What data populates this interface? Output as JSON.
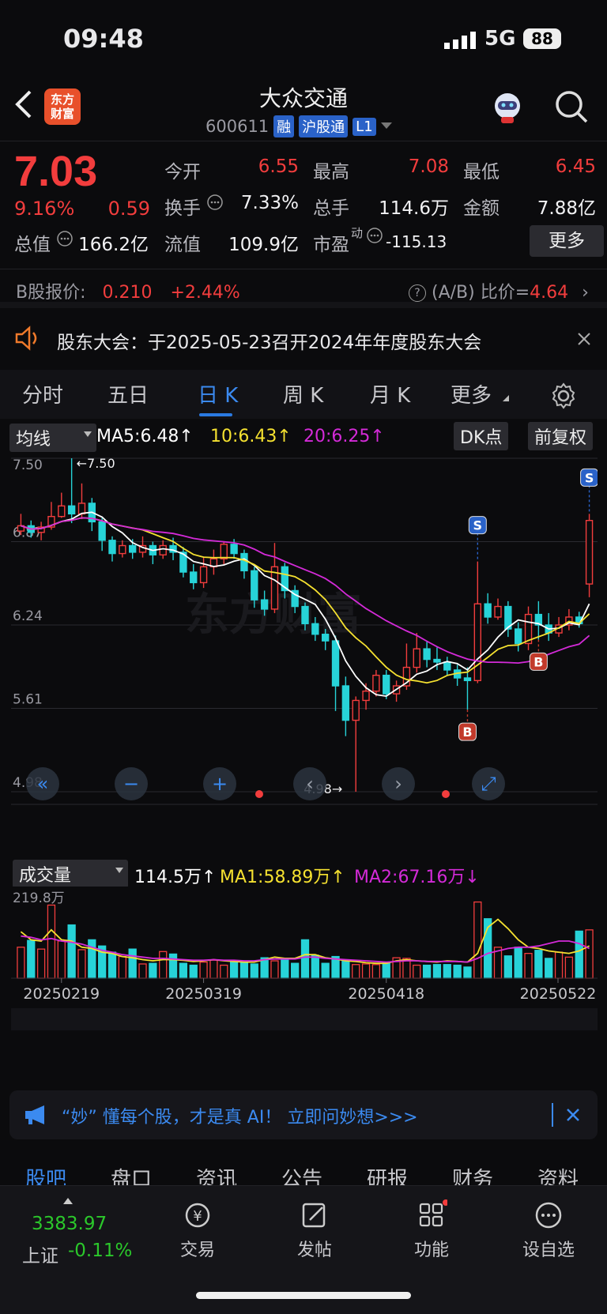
{
  "status_bar": {
    "time": "09:48",
    "network": "5G",
    "battery": "88"
  },
  "header": {
    "logo_text_line1": "东方",
    "logo_text_line2": "财富",
    "title": "大众交通",
    "code": "600611",
    "tags": [
      "融",
      "沪股通",
      "L1"
    ]
  },
  "quote": {
    "price": "7.03",
    "change_pct": "9.16%",
    "change_amt": "0.59",
    "fields": [
      {
        "label": "今开",
        "value": "6.55",
        "color": "red"
      },
      {
        "label": "最高",
        "value": "7.08",
        "color": "red"
      },
      {
        "label": "最低",
        "value": "6.45",
        "color": "red"
      },
      {
        "label": "换手",
        "value": "7.33%",
        "color": "white"
      },
      {
        "label": "总手",
        "value": "114.6万",
        "color": "white"
      },
      {
        "label": "金额",
        "value": "7.88亿",
        "color": "white"
      },
      {
        "label": "总值",
        "value": "166.2亿",
        "color": "white"
      },
      {
        "label": "流值",
        "value": "109.9亿",
        "color": "white"
      },
      {
        "label": "市盈",
        "value": "-115.13",
        "color": "white"
      }
    ],
    "pe_superscript": "动",
    "more_button": "更多"
  },
  "b_share": {
    "label": "B股报价:",
    "price": "0.210",
    "pct": "+2.44%",
    "ratio_label": "(A/B) 比价=",
    "ratio": "4.64"
  },
  "notice": {
    "text": "股东大会：于2025-05-23召开2024年年度股东大会"
  },
  "chart_tabs": [
    {
      "label": "分时"
    },
    {
      "label": "五日"
    },
    {
      "label": "日 K"
    },
    {
      "label": "周 K"
    },
    {
      "label": "月 K"
    },
    {
      "label": "更多"
    }
  ],
  "ma_row": {
    "selector": "均线",
    "ma5": "MA5:6.48↑",
    "ma10": "10:6.43↑",
    "ma20": "20:6.25↑",
    "dk_button": "DK点",
    "adjust_button": "前复权",
    "colors": {
      "ma5": "#ffffff",
      "ma10": "#f5e130",
      "ma20": "#d42ad8"
    }
  },
  "chart_data": [
    {
      "type": "candlestick",
      "y_ticks": [
        "7.50",
        "6.87",
        "6.24",
        "5.61",
        "4.98"
      ],
      "ylim": [
        4.98,
        7.5
      ],
      "max_label": "←7.50",
      "min_label": "4.98→",
      "markers": [
        {
          "type": "S",
          "index": 45
        },
        {
          "type": "S",
          "index": 56
        },
        {
          "type": "B",
          "index": 44
        },
        {
          "type": "B",
          "index": 51
        }
      ],
      "candles": [
        [
          6.95,
          6.99,
          7.08,
          6.92
        ],
        [
          6.99,
          6.94,
          7.03,
          6.9
        ],
        [
          6.94,
          6.98,
          7.02,
          6.88
        ],
        [
          6.98,
          7.06,
          7.17,
          6.96
        ],
        [
          7.06,
          7.14,
          7.24,
          7.05
        ],
        [
          7.14,
          7.08,
          7.5,
          7.01
        ],
        [
          7.08,
          7.16,
          7.31,
          7.04
        ],
        [
          7.16,
          7.02,
          7.2,
          6.95
        ],
        [
          7.02,
          6.88,
          7.05,
          6.8
        ],
        [
          6.88,
          6.78,
          6.91,
          6.72
        ],
        [
          6.78,
          6.84,
          6.88,
          6.75
        ],
        [
          6.84,
          6.79,
          6.89,
          6.74
        ],
        [
          6.79,
          6.84,
          6.91,
          6.75
        ],
        [
          6.84,
          6.77,
          6.87,
          6.7
        ],
        [
          6.77,
          6.84,
          6.88,
          6.74
        ],
        [
          6.84,
          6.79,
          6.9,
          6.73
        ],
        [
          6.79,
          6.64,
          6.83,
          6.6
        ],
        [
          6.64,
          6.56,
          6.7,
          6.51
        ],
        [
          6.56,
          6.68,
          6.75,
          6.52
        ],
        [
          6.68,
          6.74,
          6.81,
          6.62
        ],
        [
          6.74,
          6.85,
          6.87,
          6.7
        ],
        [
          6.85,
          6.78,
          6.89,
          6.74
        ],
        [
          6.78,
          6.65,
          6.81,
          6.59
        ],
        [
          6.65,
          6.43,
          6.68,
          6.37
        ],
        [
          6.43,
          6.36,
          6.5,
          6.31
        ],
        [
          6.36,
          6.68,
          6.86,
          6.33
        ],
        [
          6.68,
          6.5,
          6.71,
          6.44
        ],
        [
          6.5,
          6.38,
          6.54,
          6.33
        ],
        [
          6.38,
          6.25,
          6.41,
          6.2
        ],
        [
          6.25,
          6.17,
          6.3,
          6.12
        ],
        [
          6.17,
          6.12,
          6.21,
          6.05
        ],
        [
          6.12,
          5.78,
          6.16,
          5.59
        ],
        [
          5.78,
          5.52,
          5.85,
          5.4
        ],
        [
          5.52,
          5.67,
          5.7,
          4.98
        ],
        [
          5.67,
          5.74,
          5.8,
          5.6
        ],
        [
          5.74,
          5.86,
          5.9,
          5.7
        ],
        [
          5.86,
          5.72,
          5.9,
          5.68
        ],
        [
          5.72,
          5.78,
          5.82,
          5.66
        ],
        [
          5.78,
          5.92,
          6.1,
          5.75
        ],
        [
          5.92,
          6.06,
          6.18,
          5.88
        ],
        [
          6.06,
          5.98,
          6.12,
          5.92
        ],
        [
          5.98,
          5.96,
          6.07,
          5.9
        ],
        [
          5.96,
          5.9,
          6.0,
          5.86
        ],
        [
          5.9,
          5.84,
          5.94,
          5.78
        ],
        [
          5.84,
          5.82,
          5.92,
          5.6
        ],
        [
          5.82,
          6.4,
          6.72,
          5.8
        ],
        [
          6.4,
          6.3,
          6.48,
          6.25
        ],
        [
          6.3,
          6.38,
          6.44,
          6.28
        ],
        [
          6.38,
          6.21,
          6.42,
          6.15
        ],
        [
          6.21,
          6.1,
          6.26,
          6.04
        ],
        [
          6.1,
          6.32,
          6.38,
          6.05
        ],
        [
          6.32,
          6.24,
          6.42,
          6.13
        ],
        [
          6.24,
          6.18,
          6.33,
          6.12
        ],
        [
          6.18,
          6.24,
          6.3,
          6.15
        ],
        [
          6.24,
          6.3,
          6.36,
          6.2
        ],
        [
          6.3,
          6.25,
          6.34,
          6.22
        ],
        [
          6.55,
          7.03,
          7.08,
          6.45
        ]
      ]
    },
    {
      "type": "bar",
      "y_max_label": "219.8万",
      "x_labels": [
        "20250219",
        "20250319",
        "20250418",
        "20250522"
      ],
      "volume": [
        50,
        61,
        47,
        118,
        60,
        86,
        46,
        62,
        52,
        42,
        35,
        47,
        23,
        24,
        43,
        39,
        24,
        21,
        26,
        29,
        21,
        27,
        25,
        23,
        33,
        28,
        30,
        24,
        62,
        37,
        24,
        35,
        29,
        22,
        23,
        22,
        26,
        33,
        32,
        21,
        21,
        22,
        22,
        21,
        18,
        123,
        96,
        50,
        36,
        50,
        40,
        45,
        32,
        42,
        34,
        76,
        78
      ],
      "ma1": [
        75,
        62,
        60,
        78,
        62,
        60,
        50,
        48,
        42,
        40,
        35,
        33,
        30,
        28,
        30,
        30,
        29,
        27,
        28,
        30,
        28,
        27,
        26,
        26,
        30,
        34,
        32,
        32,
        38,
        38,
        33,
        31,
        28,
        27,
        25,
        24,
        24,
        28,
        30,
        28,
        27,
        26,
        28,
        27,
        26,
        40,
        82,
        95,
        80,
        62,
        50,
        48,
        44,
        42,
        40,
        44,
        52
      ],
      "ma2": [
        68,
        66,
        62,
        64,
        60,
        58,
        55,
        50,
        45,
        42,
        38,
        36,
        34,
        32,
        32,
        31,
        30,
        29,
        29,
        30,
        29,
        29,
        28,
        28,
        30,
        31,
        31,
        31,
        34,
        34,
        32,
        31,
        30,
        29,
        28,
        27,
        26,
        27,
        28,
        28,
        27,
        27,
        27,
        27,
        26,
        32,
        40,
        44,
        48,
        50,
        50,
        52,
        56,
        60,
        60,
        56,
        48
      ]
    }
  ],
  "volume_row": {
    "selector": "成交量",
    "vol": "114.5万↑",
    "ma1": "MA1:58.89万↑",
    "ma2": "MA2:67.16万↓",
    "colors": {
      "ma1": "#f5e130",
      "ma2": "#d42ad8"
    }
  },
  "ai_banner": {
    "text": "“妙” 懂每个股，才是真 AI！ 立即问妙想>>>"
  },
  "bottom_tabs": [
    {
      "label": "股吧"
    },
    {
      "label": "盘口"
    },
    {
      "label": "资讯"
    },
    {
      "label": "公告"
    },
    {
      "label": "研报"
    },
    {
      "label": "财务"
    },
    {
      "label": "资料"
    }
  ],
  "bottom_bar": {
    "index_value": "3383.97",
    "index_name": "上证",
    "index_pct": "-0.11%",
    "items": [
      {
        "label": "交易"
      },
      {
        "label": "发帖"
      },
      {
        "label": "功能"
      },
      {
        "label": "设自选"
      }
    ]
  }
}
